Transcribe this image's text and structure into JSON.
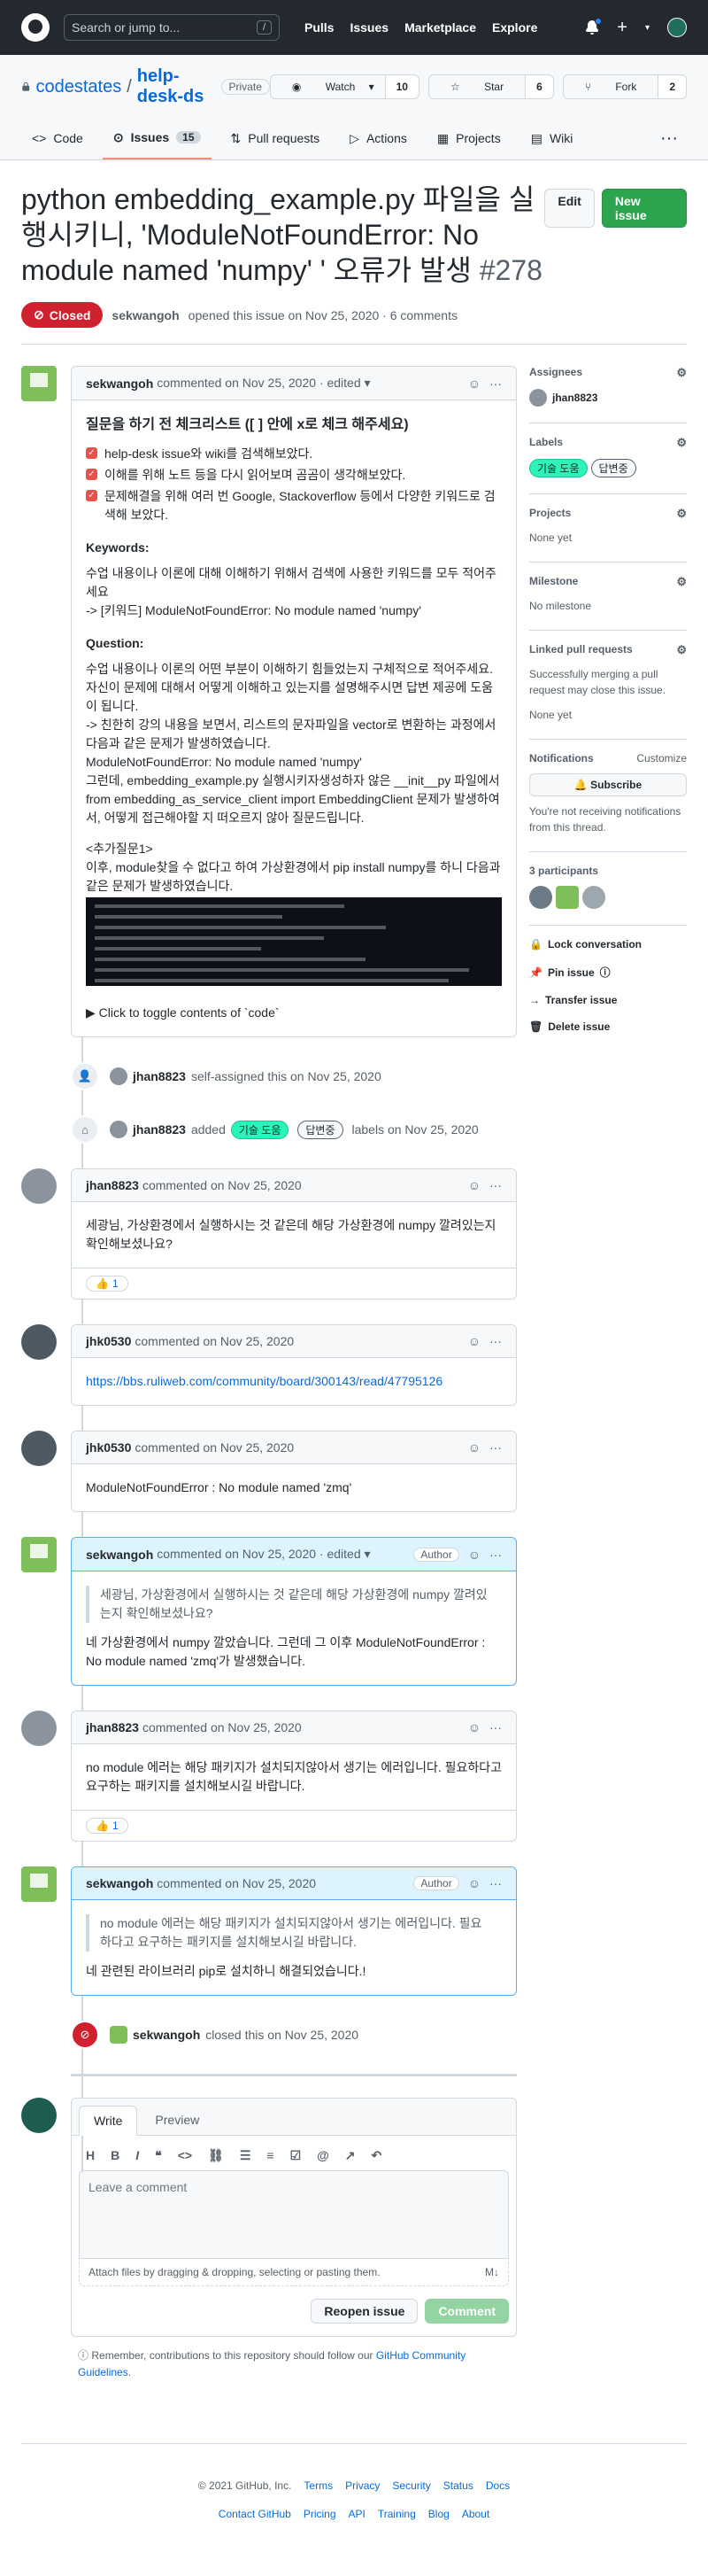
{
  "header": {
    "search_placeholder": "Search or jump to...",
    "search_key": "/",
    "nav": [
      "Pulls",
      "Issues",
      "Marketplace",
      "Explore"
    ],
    "plus_label": "+",
    "caret": "▾"
  },
  "repo": {
    "owner": "codestates",
    "separator": "/",
    "name": "help-desk-ds",
    "visibility": "Private",
    "watch_label": "Watch",
    "watch_count": "10",
    "star_label": "Star",
    "star_count": "6",
    "fork_label": "Fork",
    "fork_count": "2",
    "tabs": {
      "code": "Code",
      "issues": "Issues",
      "issues_count": "15",
      "pulls": "Pull requests",
      "actions": "Actions",
      "projects": "Projects",
      "wiki": "Wiki"
    },
    "more": "···"
  },
  "issue": {
    "title": "python embedding_example.py 파일을 실행시키니, 'ModuleNotFoundError: No module named 'numpy' ' 오류가 발생",
    "number": "#278",
    "edit_label": "Edit",
    "new_label": "New issue",
    "state": "Closed",
    "author": "sekwangoh",
    "opened_text": "opened this issue on Nov 25, 2020 · 6 comments"
  },
  "comments": {
    "c1": {
      "author": "sekwangoh",
      "meta": "commented on Nov 25, 2020 · edited ▾",
      "heading": "질문을 하기 전 체크리스트 ([ ] 안에 x로 체크 해주세요)",
      "checks": [
        "help-desk issue와 wiki를 검색해보았다.",
        "이해를 위해 노트 등을 다시 읽어보며 곰곰이 생각해보았다.",
        "문제해결을 위해 여러 번 Google, Stackoverflow 등에서 다양한 키워드로 검색해 보았다."
      ],
      "keywords_title": "Keywords:",
      "keywords_1": "수업 내용이나 이론에 대해 이해하기 위해서 검색에 사용한 키워드를 모두 적어주세요",
      "keywords_2": "-> [키워드] ModuleNotFoundError: No module named 'numpy'",
      "question_title": "Question:",
      "question_1": "수업 내용이나 이론의 어떤 부분이 이해하기 힘들었는지 구체적으로 적어주세요. 자신이 문제에 대해서 어떻게 이해하고 있는지를 설명해주시면 답변 제공에 도움이 됩니다.",
      "question_2": "-> 친한히 강의 내용을 보면서, 리스트의 문자파일을 vector로 변환하는 과정에서 다음과 같은 문제가 발생하였습니다.",
      "question_3": "ModuleNotFoundError: No module named 'numpy'",
      "question_4": "그런데, embedding_example.py 실행시키자생성하자 않은 __init__py 파일에서 from embedding_as_service_client import EmbeddingClient 문제가 발생하여서, 어떻게 접근해야할 지 떠오르지 않아 질문드립니다.",
      "extra_title": "<추가질문1>",
      "extra_1": "이후, module찾을 수 없다고 하여 가상환경에서 pip install numpy를 하니 다음과 같은 문제가 발생하였습니다.",
      "details": "▶ Click to toggle contents of `code`"
    },
    "ev1": {
      "user": "jhan8823",
      "text": "self-assigned this on Nov 25, 2020"
    },
    "ev2": {
      "user": "jhan8823",
      "pre": "added",
      "labels": [
        "기술 도움",
        "답변중"
      ],
      "post": "labels on Nov 25, 2020"
    },
    "c2": {
      "author": "jhan8823",
      "meta": "commented on Nov 25, 2020",
      "body": "세광님, 가상환경에서 실행하시는 것 같은데 해당 가상환경에 numpy 깔려있는지 확인해보셨나요?",
      "reaction": "👍",
      "reaction_count": "1"
    },
    "c3": {
      "author": "jhk0530",
      "meta": "commented on Nov 25, 2020",
      "body": "https://bbs.ruliweb.com/community/board/300143/read/47795126"
    },
    "c4": {
      "author": "jhk0530",
      "meta": "commented on Nov 25, 2020",
      "body": "ModuleNotFoundError : No module named 'zmq'"
    },
    "c5": {
      "author": "sekwangoh",
      "meta": "commented on Nov 25, 2020 · edited ▾",
      "role": "Author",
      "quote": "세광님, 가상환경에서 실행하시는 것 같은데 해당 가상환경에 numpy 깔려있는지 확인해보셨나요?",
      "body": "네 가상환경에서 numpy 깔았습니다. 그런데 그 이후 ModuleNotFoundError : No module named 'zmq'가 발생했습니다."
    },
    "c6": {
      "author": "jhan8823",
      "meta": "commented on Nov 25, 2020",
      "body": "no module 에러는 해당 패키지가 설치되지않아서 생기는 에러입니다. 필요하다고 요구하는 패키지를 설치해보시길 바랍니다.",
      "reaction": "👍",
      "reaction_count": "1"
    },
    "c7": {
      "author": "sekwangoh",
      "meta": "commented on Nov 25, 2020",
      "role": "Author",
      "quote": "no module 에러는 해당 패키지가 설치되지않아서 생기는 에러입니다. 필요하다고 요구하는 패키지를 설치해보시길 바랍니다.",
      "body": "네 관련된 라이브러리 pip로 설치하니 해결되었습니다.!"
    },
    "ev3": {
      "user": "sekwangoh",
      "text": "closed this on Nov 25, 2020"
    }
  },
  "editor": {
    "tab_write": "Write",
    "tab_preview": "Preview",
    "placeholder": "Leave a comment",
    "attach_text": "Attach files by dragging & dropping, selecting or pasting them.",
    "md_badge": "M↓",
    "reopen_label": "Reopen issue",
    "comment_label": "Comment",
    "note_pre": "Remember, contributions to this repository should follow our",
    "note_link": "GitHub Community Guidelines",
    "note_post": "."
  },
  "sidebar": {
    "assignees_title": "Assignees",
    "assignee": "jhan8823",
    "labels_title": "Labels",
    "labels": [
      "기술 도움",
      "답변중"
    ],
    "projects_title": "Projects",
    "projects_value": "None yet",
    "milestone_title": "Milestone",
    "milestone_value": "No milestone",
    "linked_title": "Linked pull requests",
    "linked_desc": "Successfully merging a pull request may close this issue.",
    "linked_value": "None yet",
    "notif_title": "Notifications",
    "notif_customize": "Customize",
    "subscribe_label": "Subscribe",
    "notif_desc": "You're not receiving notifications from this thread.",
    "participants_title": "3 participants",
    "lock_label": "Lock conversation",
    "pin_label": "Pin issue",
    "transfer_label": "Transfer issue",
    "delete_label": "Delete issue"
  },
  "footer": {
    "copyright": "© 2021 GitHub, Inc.",
    "row1": [
      "Terms",
      "Privacy",
      "Security",
      "Status",
      "Docs"
    ],
    "row2": [
      "Contact GitHub",
      "Pricing",
      "API",
      "Training",
      "Blog",
      "About"
    ]
  }
}
